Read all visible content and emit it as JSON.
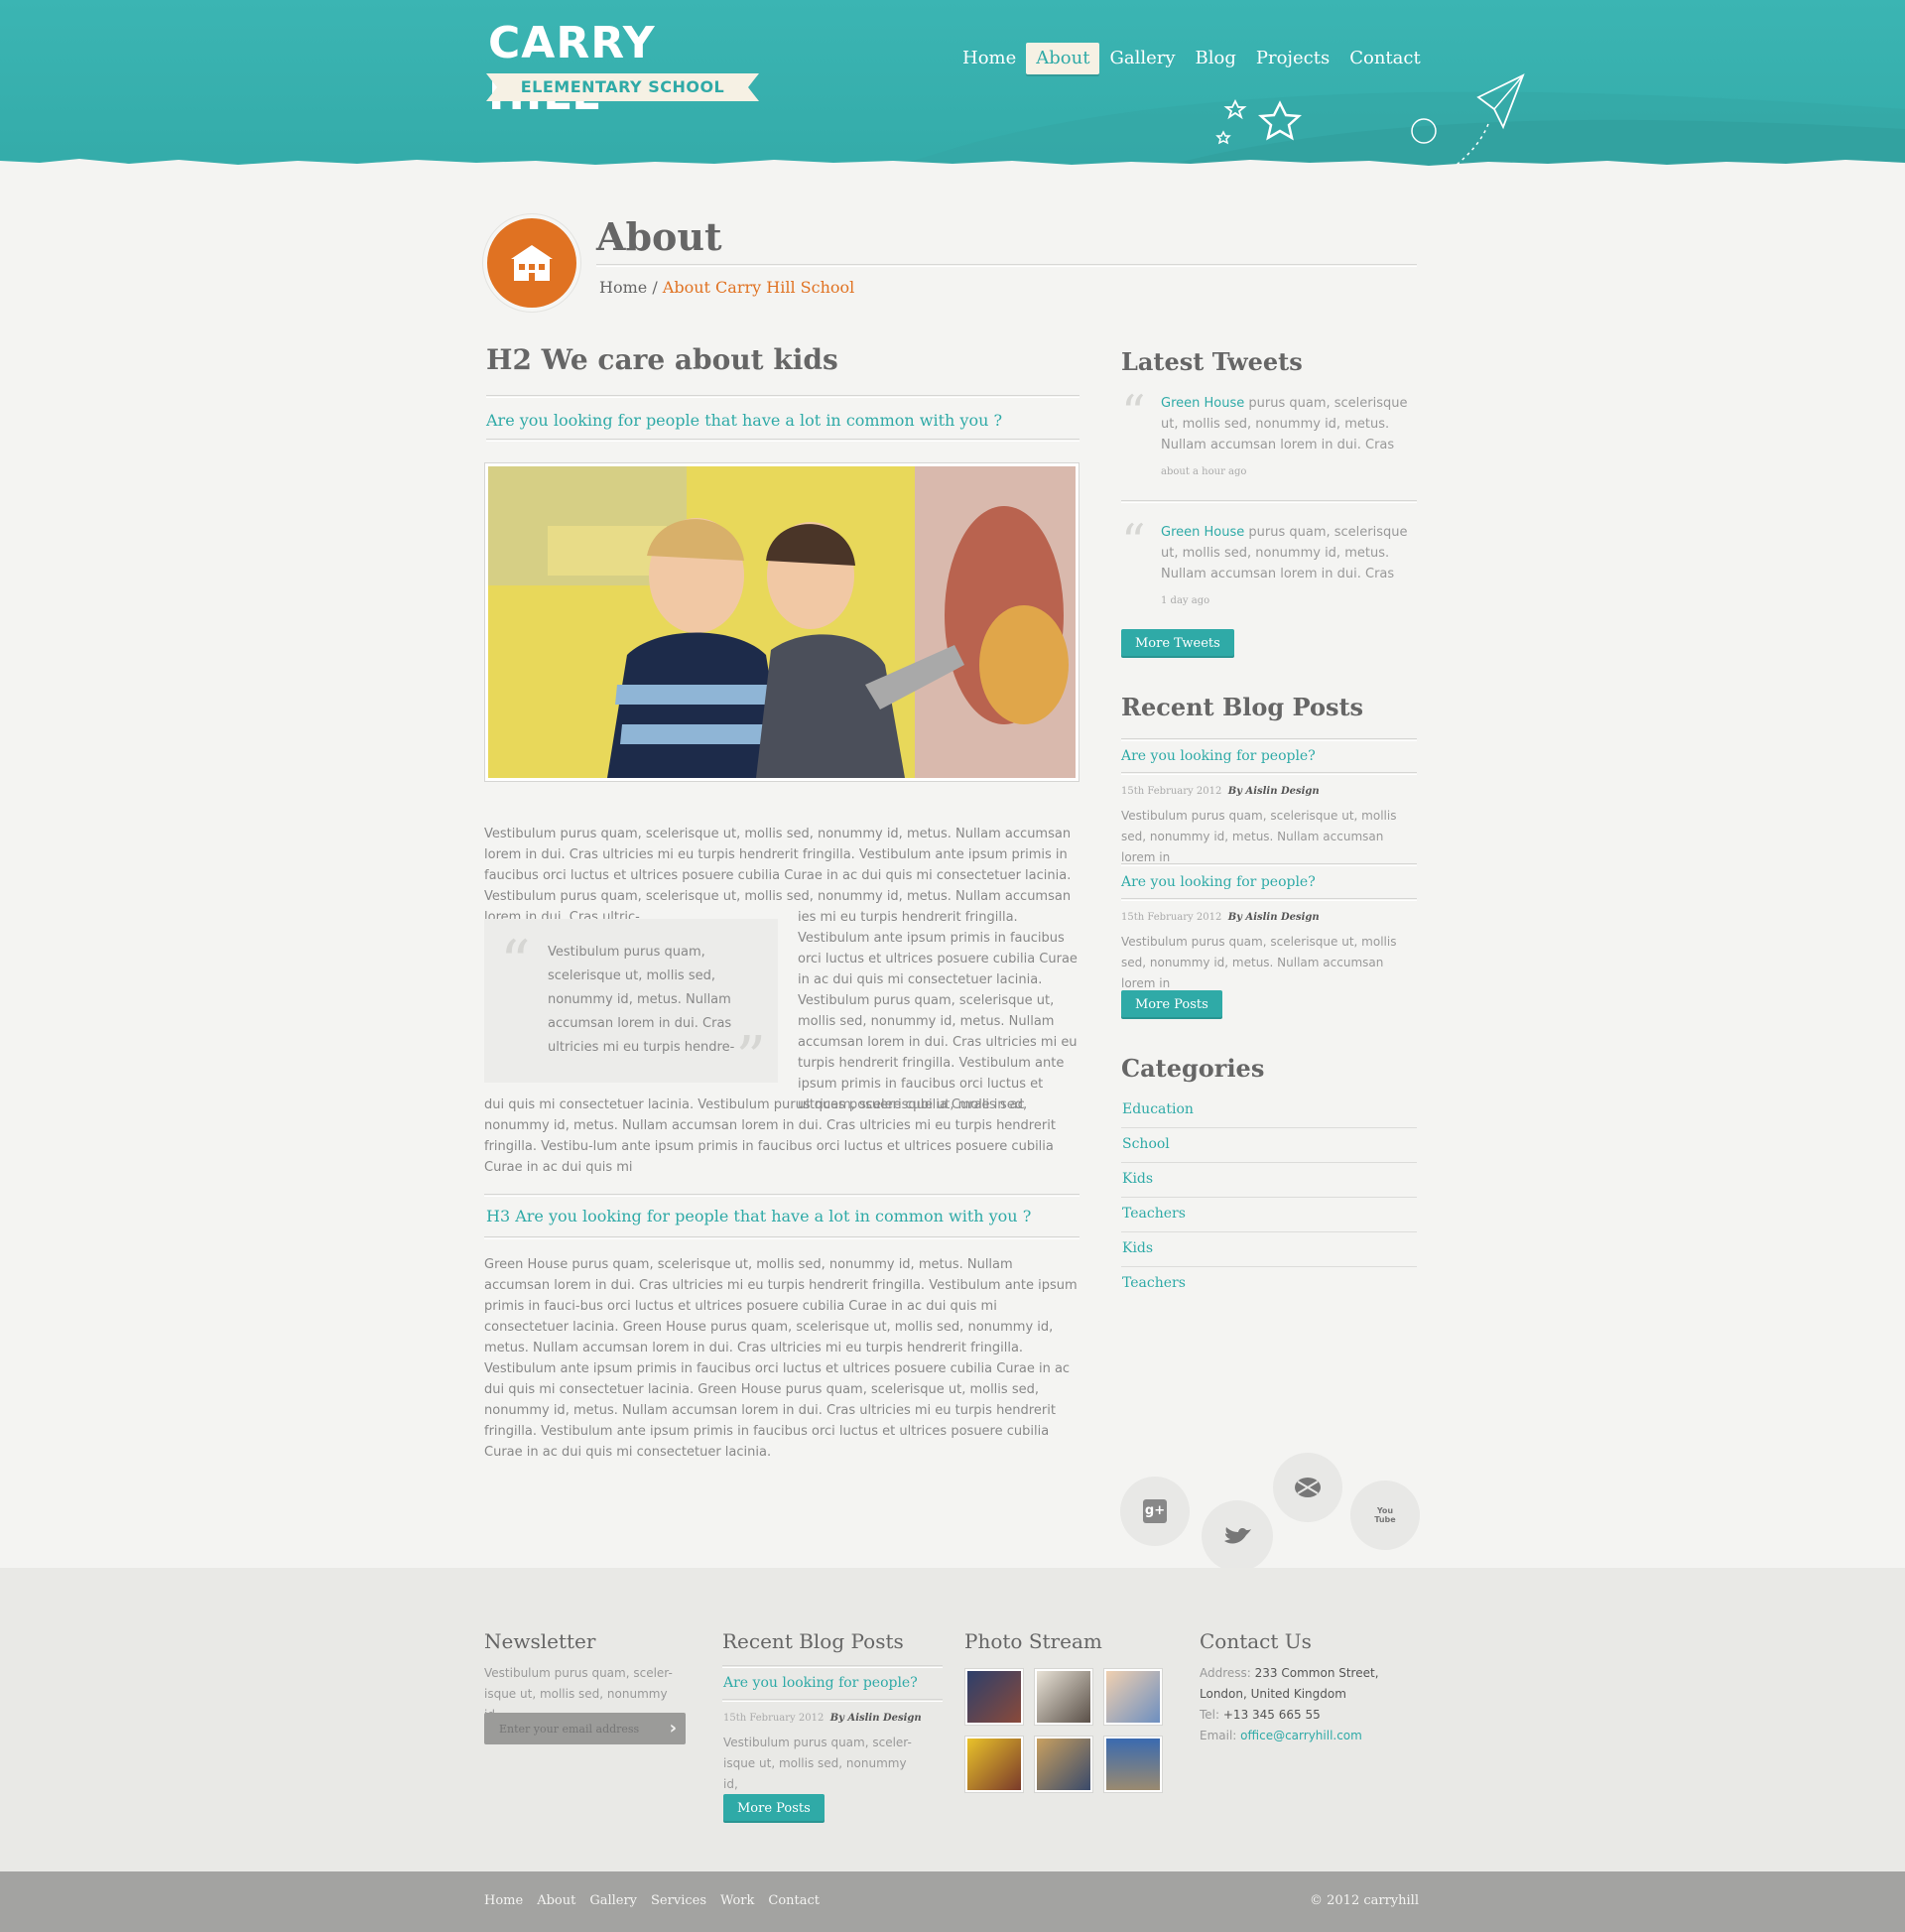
{
  "header": {
    "logo_title": "CARRY HILL",
    "logo_subtitle": "ELEMENTARY SCHOOL",
    "nav": [
      "Home",
      "About",
      "Gallery",
      "Blog",
      "Projects",
      "Contact"
    ],
    "active_nav": "About"
  },
  "page": {
    "title": "About",
    "breadcrumb_home": "Home",
    "breadcrumb_sep": " / ",
    "breadcrumb_current": "About Carry Hill School"
  },
  "main": {
    "h2": "H2 We care about kids",
    "subhead": "Are you looking for people that have a lot in common with you ?",
    "paragraph1": "Vestibulum purus quam, scelerisque ut, mollis sed, nonummy id, metus. Nullam accumsan lorem in dui. Cras ultricies mi eu turpis hendrerit fringilla. Vestibulum ante ipsum primis in faucibus orci luctus et ultrices posuere cubilia Curae in ac dui quis mi consectetuer lacinia. Vestibulum purus quam, scelerisque ut, mollis sed, nonummy id, metus. Nullam accumsan lorem in dui. Cras ultric-",
    "quote": "Vestibulum purus quam, scelerisque ut, mollis sed, nonummy id, metus. Nullam accumsan lorem in dui. Cras ultricies mi eu turpis hendre-",
    "paragraph_right": "ies mi eu turpis hendrerit fringilla. Vestibulum ante ipsum primis in faucibus orci luctus et ultrices posuere cubilia Curae in ac dui quis mi consectetuer lacinia. Vestibulum purus quam, scelerisque ut, mollis sed, nonummy id, metus. Nullam accumsan lorem in dui. Cras ultricies mi eu turpis hendrerit fringilla. Vestibulum ante ipsum primis in faucibus orci luctus et ultrices posuere cubilia Curae in ac",
    "paragraph_after": "dui quis mi consectetuer lacinia. Vestibulum purus quam, scelerisque ut, mollis sed, nonummy id, metus. Nullam accumsan lorem in dui. Cras ultricies mi eu turpis hendrerit fringilla. Vestibu-lum ante ipsum primis in faucibus orci luctus et ultrices posuere cubilia Curae in ac dui quis mi",
    "h3": "H3 Are you looking for people that have a lot in common with you ?",
    "paragraph_last": "Green House purus quam, scelerisque ut, mollis sed, nonummy id, metus. Nullam accumsan lorem in dui. Cras ultricies mi eu turpis hendrerit fringilla. Vestibulum ante ipsum primis in fauci-bus orci luctus et ultrices posuere cubilia Curae in ac dui quis mi consectetuer lacinia. Green House purus quam, scelerisque ut, mollis sed, nonummy id, metus. Nullam accumsan lorem in dui. Cras ultricies mi eu turpis hendrerit fringilla. Vestibulum ante ipsum primis in faucibus orci luctus et ultrices posuere cubilia Curae in ac dui quis mi consectetuer lacinia. Green House purus quam, scelerisque ut, mollis sed, nonummy id, metus. Nullam accumsan lorem in dui. Cras ultricies mi eu turpis hendrerit fringilla. Vestibulum ante ipsum primis in faucibus orci luctus et ultrices posuere cubilia Curae in ac dui quis mi consectetuer lacinia."
  },
  "sidebar": {
    "tweets_title": "Latest Tweets",
    "tweets": [
      {
        "author": "Green House",
        "text": " purus quam, scelerisque ut, mollis sed, nonummy id, metus. Nullam accumsan lorem in dui. Cras",
        "time": "about a hour ago"
      },
      {
        "author": "Green House",
        "text": " purus quam, scelerisque ut, mollis sed, nonummy id, metus. Nullam accumsan lorem in dui. Cras",
        "time": "1 day ago"
      }
    ],
    "more_tweets": "More Tweets",
    "posts_title": "Recent Blog Posts",
    "posts": [
      {
        "title": "Are you looking for people?",
        "date": "15th February 2012",
        "by": "By Aislin Design",
        "excerpt": "Vestibulum purus quam, scelerisque ut, mollis sed, nonummy id, metus. Nullam accumsan lorem in"
      },
      {
        "title": "Are you looking for people?",
        "date": "15th February 2012",
        "by": "By Aislin Design",
        "excerpt": "Vestibulum purus quam, scelerisque ut, mollis sed, nonummy id, metus. Nullam accumsan lorem in"
      }
    ],
    "more_posts": "More Posts",
    "categories_title": "Categories",
    "categories": [
      "Education",
      "School",
      "Kids",
      "Teachers",
      "Kids",
      "Teachers"
    ]
  },
  "social": {
    "googleplus": "g+",
    "youtube": "You Tube"
  },
  "footer": {
    "newsletter_title": "Newsletter",
    "newsletter_text": "Vestibulum purus quam, sceler-isque ut, mollis sed, nonummy id,",
    "newsletter_placeholder": "Enter your email address",
    "blog_title": "Recent Blog Posts",
    "blog_post_title": "Are you looking for people?",
    "blog_post_date": "15th February 2012",
    "blog_post_by": "By Aislin Design",
    "blog_post_excerpt": "Vestibulum purus quam, sceler-isque ut, mollis sed, nonummy id,",
    "blog_more": "More Posts",
    "photos_title": "Photo Stream",
    "contact_title": "Contact Us",
    "address_label": "Address: ",
    "address_value": "233 Common Street,",
    "address_line2": "London, United Kingdom",
    "tel_label": "Tel: ",
    "tel_value": "+13 345 665 55",
    "email_label": "Email: ",
    "email_value": "office@carryhill.com"
  },
  "bottom": {
    "nav": [
      "Home",
      "About",
      "Gallery",
      "Services",
      "Work",
      "Contact"
    ],
    "copyright": "© 2012 carryhill"
  },
  "colors": {
    "teal": "#2faaa7",
    "orange": "#e07222",
    "cream": "#f6f1e4"
  }
}
